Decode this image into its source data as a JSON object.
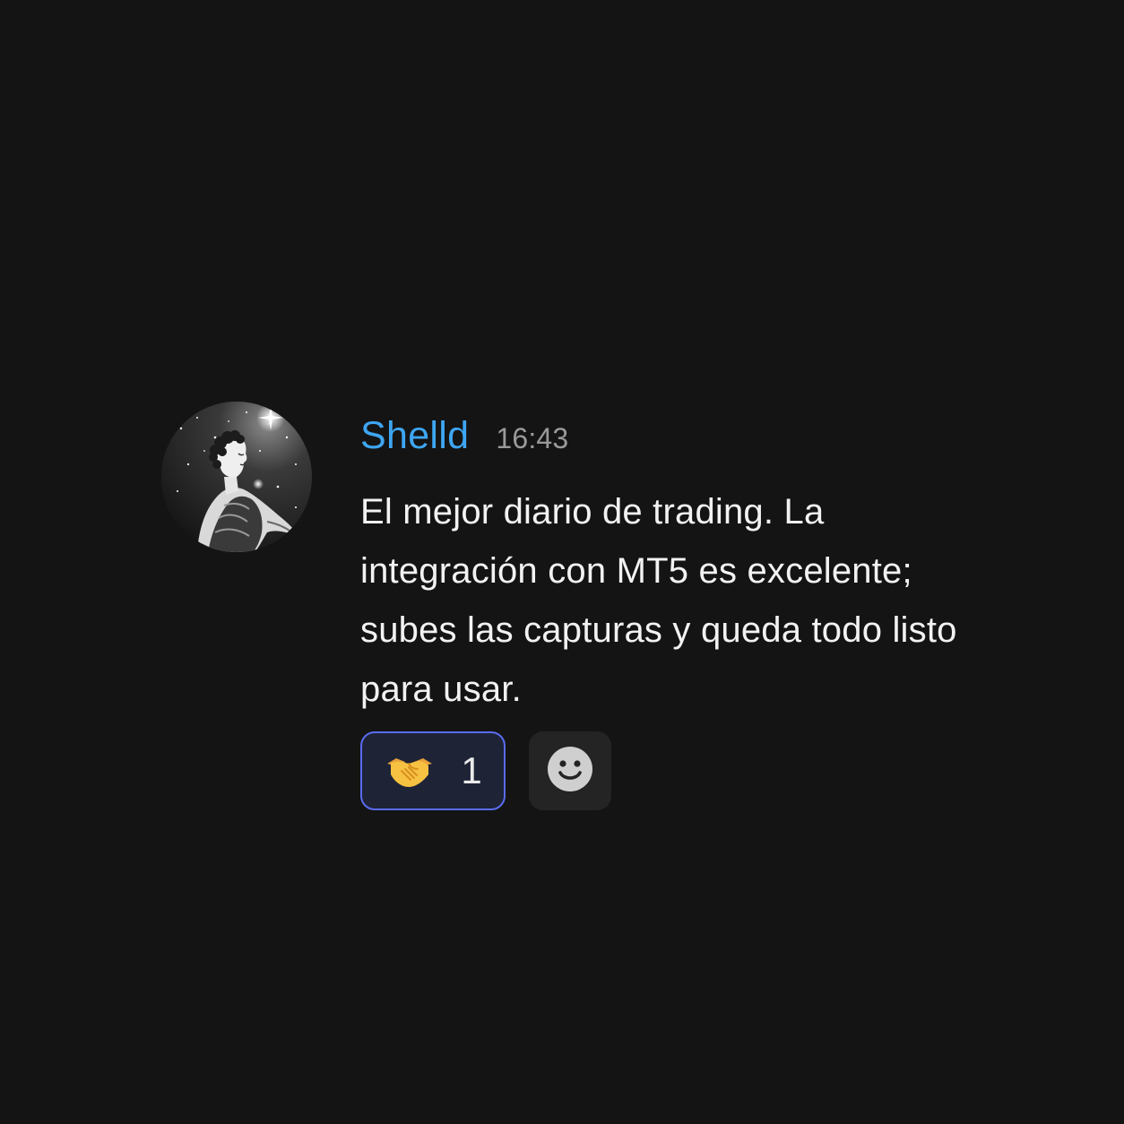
{
  "message": {
    "author": "Shelld",
    "time": "16:43",
    "text": "El mejor diario de trading. La integración con MT5 es excelente; subes las capturas y queda todo listo para usar."
  },
  "reactions": [
    {
      "emoji_icon": "handshake-icon",
      "count": "1",
      "selected": true
    }
  ],
  "add_reaction_icon": "smiley-icon",
  "colors": {
    "background": "#141414",
    "username": "#3ea6f2",
    "timestamp": "#9a9a9a",
    "text": "#f2f2f2",
    "reaction_border": "#5a6cf0",
    "reaction_bg": "#1e2336",
    "add_reaction_bg": "#242424"
  }
}
